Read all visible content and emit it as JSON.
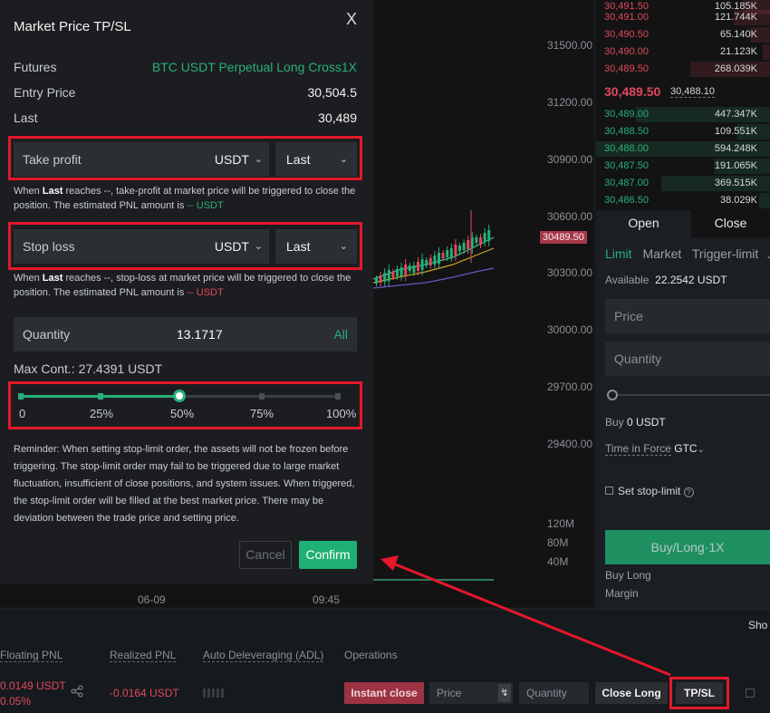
{
  "modal": {
    "title": "Market Price TP/SL",
    "close_icon": "X",
    "futures_label": "Futures",
    "futures_value": "BTC USDT Perpetual Long Cross1X",
    "entry_label": "Entry Price",
    "entry_value": "30,504.5",
    "last_label": "Last",
    "last_value": "30,489",
    "take_profit": {
      "label": "Take profit",
      "unit": "USDT",
      "trigger": "Last",
      "hint_pre": "When ",
      "hint_bold": "Last",
      "hint_mid": " reaches --, take-profit at market price will be triggered to close the position. The estimated PNL amount is ",
      "hint_amount": "-- USDT"
    },
    "stop_loss": {
      "label": "Stop loss",
      "unit": "USDT",
      "trigger": "Last",
      "hint_pre": "When ",
      "hint_bold": "Last",
      "hint_mid": " reaches --, stop-loss at market price will be triggered to close the position. The estimated PNL amount is ",
      "hint_amount": "-- USDT"
    },
    "quantity_label": "Quantity",
    "quantity_value": "13.1717",
    "all_label": "All",
    "max_cont": "Max Cont.:  27.4391 USDT",
    "slider_value_pct": 50,
    "percent_labels": [
      "0",
      "25%",
      "50%",
      "75%",
      "100%"
    ],
    "reminder": "Reminder: When setting stop-limit order, the assets will not be frozen before triggering. The stop-limit order may fail to be triggered due to large market fluctuation, insufficient of close positions, and system issues. When triggered, the stop-limit order will be filled at the best market price. There may be deviation between the trade price and setting price.",
    "cancel_label": "Cancel",
    "confirm_label": "Confirm"
  },
  "chart": {
    "price_labels": [
      "31500.00",
      "31200.00",
      "30900.00",
      "30600.00",
      "30300.00",
      "30000.00",
      "29700.00",
      "29400.00"
    ],
    "volume_labels": [
      "120M",
      "80M",
      "40M"
    ],
    "current_price_tag": "30489.50",
    "time_labels": [
      "06-09",
      "09:45"
    ]
  },
  "orderbook": {
    "asks": [
      {
        "price": "30,491.00",
        "qty": "121.744K"
      },
      {
        "price": "30,490.50",
        "qty": "65.140K"
      },
      {
        "price": "30,490.00",
        "qty": "21.123K"
      },
      {
        "price": "30,489.50",
        "qty": "268.039K"
      }
    ],
    "mid_price": "30,489.50",
    "mid_mark": "30,488.10",
    "bids": [
      {
        "price": "30,489.00",
        "qty": "447.347K"
      },
      {
        "price": "30,488.50",
        "qty": "109.551K"
      },
      {
        "price": "30,488.00",
        "qty": "594.248K"
      },
      {
        "price": "30,487.50",
        "qty": "191.065K"
      },
      {
        "price": "30,487.00",
        "qty": "369.515K"
      },
      {
        "price": "30,486.50",
        "qty": "38.029K"
      }
    ]
  },
  "trade_panel": {
    "tab_open": "Open",
    "tab_close": "Close",
    "order_types": [
      "Limit",
      "Market",
      "Trigger-limit"
    ],
    "available": "Available",
    "available_value": "22.2542 USDT",
    "price_placeholder": "Price",
    "quantity_placeholder": "Quantity",
    "buy_label": "Buy",
    "buy_value": "0 USDT",
    "tif_label": "Time in Force",
    "tif_value": "GTC",
    "stop_limit_label": "Set stop-limit",
    "buy_button": "Buy/Long·1X",
    "buy_long": "Buy Long",
    "margin": "Margin"
  },
  "positions": {
    "headers": [
      "Floating PNL",
      "Realized PNL",
      "Auto Deleveraging (ADL)",
      "Operations"
    ],
    "floating_pnl": "0.0149 USDT",
    "floating_pct": "0.05%",
    "realized_pnl": "-0.0164 USDT",
    "instant_close": "Instant close",
    "price_placeholder": "Price",
    "quantity_placeholder": "Quantity",
    "close_long": "Close Long",
    "tpsl": "TP/SL"
  },
  "colors": {
    "accent_green": "#27b07a",
    "accent_red": "#e0485d",
    "highlight_outline": "#e4172b"
  }
}
